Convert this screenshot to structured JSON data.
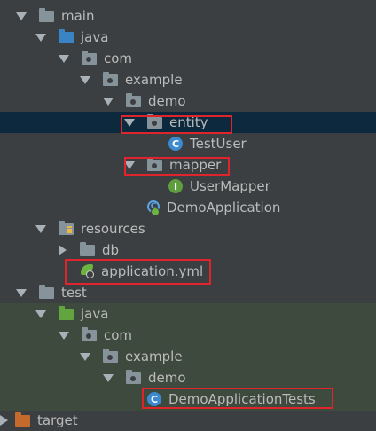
{
  "tree": {
    "main": "main",
    "java": "java",
    "com": "com",
    "example": "example",
    "demo": "demo",
    "entity": "entity",
    "test_user": "TestUser",
    "mapper": "mapper",
    "user_mapper": "UserMapper",
    "demo_application": "DemoApplication",
    "resources": "resources",
    "db": "db",
    "application_yml": "application.yml",
    "test": "test",
    "test_java": "java",
    "test_com": "com",
    "test_example": "example",
    "test_demo": "demo",
    "demo_application_tests": "DemoApplicationTests",
    "target": "target"
  },
  "icons": {
    "class": "C",
    "interface": "I"
  },
  "colors": {
    "highlight_box": "#e0242c",
    "selection": "#0d293e",
    "test_section": "#3f4a3e"
  }
}
